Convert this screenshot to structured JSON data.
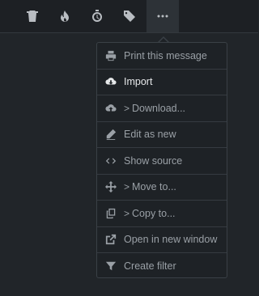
{
  "toolbar": {
    "buttons": [
      {
        "icon": "trash-icon"
      },
      {
        "icon": "flame-icon"
      },
      {
        "icon": "stopwatch-icon"
      },
      {
        "icon": "tag-icon"
      },
      {
        "icon": "more-icon",
        "active": true
      }
    ]
  },
  "menu": {
    "items": [
      {
        "label": "Print this message",
        "icon": "print-icon",
        "enabled": false
      },
      {
        "label": "Import",
        "icon": "cloud-download-icon",
        "enabled": true
      },
      {
        "label": "Download...",
        "icon": "cloud-upload-icon",
        "enabled": false,
        "submenu": true
      },
      {
        "label": "Edit as new",
        "icon": "pencil-icon",
        "enabled": false
      },
      {
        "label": "Show source",
        "icon": "code-icon",
        "enabled": false
      },
      {
        "label": "Move to...",
        "icon": "move-icon",
        "enabled": false,
        "submenu": true
      },
      {
        "label": "Copy to...",
        "icon": "copy-icon",
        "enabled": false,
        "submenu": true
      },
      {
        "label": "Open in new window",
        "icon": "external-link-icon",
        "enabled": false
      },
      {
        "label": "Create filter",
        "icon": "filter-icon",
        "enabled": false
      }
    ],
    "submenu_glyph": ">"
  }
}
